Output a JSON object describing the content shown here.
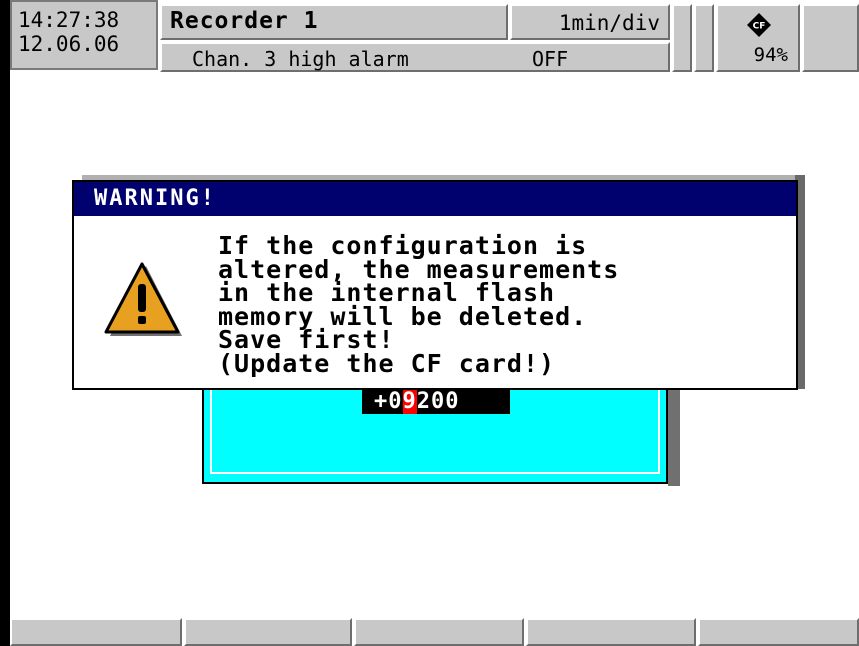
{
  "header": {
    "time": "14:27:38",
    "date": "12.06.06",
    "title": "Recorder 1",
    "time_scale": "1min/div",
    "status_message": "Chan. 3 high alarm",
    "status_value": "OFF",
    "cf_icon": "cf-card-icon",
    "cf_usage": "94%"
  },
  "background_dialog": {
    "value_prefix": "+0",
    "value_cursor_digit": "9",
    "value_suffix": "200"
  },
  "warning_dialog": {
    "title": "WARNING!",
    "icon": "warning-triangle-icon",
    "lines": [
      "If the configuration is",
      "altered, the measurements",
      "in the internal flash",
      "memory will be deleted.",
      "Save first!",
      "(Update the CF card!)"
    ]
  },
  "softkeys": [
    "",
    "",
    "",
    "",
    ""
  ],
  "colors": {
    "panel_gray": "#c8c8c8",
    "title_bar": "#00006e",
    "dialog_cyan": "#00ffff",
    "cursor_red": "#ff0000",
    "warning_orange": "#e8a020"
  }
}
